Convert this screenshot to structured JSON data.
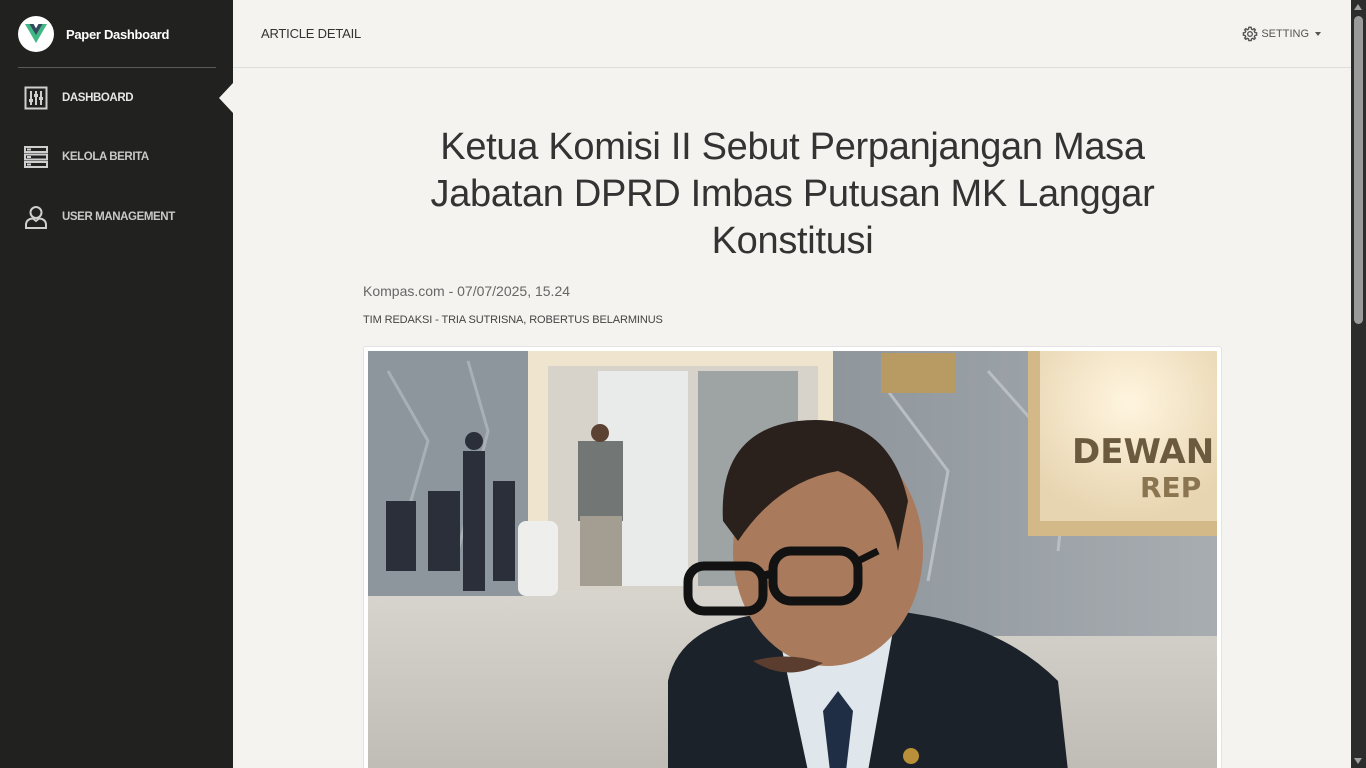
{
  "sidebar": {
    "brand": "Paper Dashboard",
    "items": [
      {
        "label": "DASHBOARD",
        "icon": "dashboard-icon",
        "active": true
      },
      {
        "label": "KELOLA BERITA",
        "icon": "list-icon",
        "active": false
      },
      {
        "label": "USER MANAGEMENT",
        "icon": "user-icon",
        "active": false
      }
    ]
  },
  "navbar": {
    "title": "ARTICLE DETAIL",
    "settings_label": "SETTING"
  },
  "article": {
    "title": "Ketua Komisi II Sebut Perpanjangan Masa Jabatan DPRD Imbas Putusan MK Langgar Konstitusi",
    "source_date": "Kompas.com - 07/07/2025, 15.24",
    "authors": "TIM REDAKSI - TRIA SUTRISNA, ROBERTUS BELARMINUS"
  },
  "colors": {
    "sidebar_bg": "#212120",
    "content_bg": "#f4f3ef",
    "brand_accent": "#41b883"
  }
}
